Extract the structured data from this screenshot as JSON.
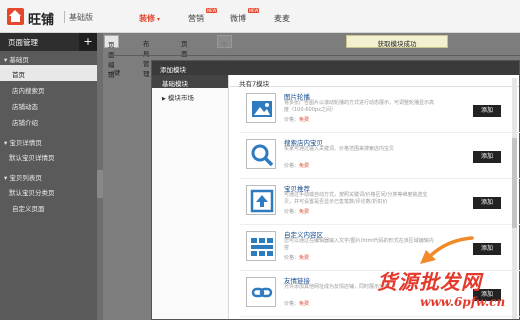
{
  "header": {
    "brand": "旺铺",
    "edition": "基础版",
    "nav": [
      {
        "label": "装修",
        "active": true,
        "caret": "▾"
      },
      {
        "label": "营销",
        "badge": "NEW"
      },
      {
        "label": "微博",
        "badge": "NEW"
      },
      {
        "label": "麦麦"
      }
    ]
  },
  "sidebar": {
    "title": "页面管理",
    "add_icon": "plus-icon",
    "groups": [
      {
        "label": "基础页",
        "items": [
          {
            "label": "首页",
            "active": true
          },
          {
            "label": "店内搜索页"
          },
          {
            "label": "店铺动态"
          },
          {
            "label": "店铺介绍"
          }
        ]
      },
      {
        "label": "宝贝详情页",
        "items": [
          {
            "label": "默认宝贝详情页"
          }
        ]
      },
      {
        "label": "宝贝列表页",
        "items": [
          {
            "label": "默认宝贝分类页"
          },
          {
            "label": "自定义页面"
          }
        ]
      }
    ]
  },
  "workspace": {
    "tabs": [
      {
        "label": "页面编辑",
        "active": true
      },
      {
        "label": "布局管理"
      },
      {
        "label": "页面属性"
      },
      {
        "label": "不可编辑",
        "disabled": true
      }
    ],
    "toast": "获取模块成功",
    "stub": "一键"
  },
  "modal": {
    "title": "添加模块",
    "left_header": "基础模块",
    "left_items": [
      {
        "label": "模块市场",
        "icon": "triangle-right-icon"
      }
    ],
    "right_header": "共有7模块",
    "price_label": "价格：",
    "modules": [
      {
        "name": "图片轮播",
        "desc": "将多张广告图片以滚动轮播的方式进行动态展示，可调整轮播显示高度（100-600px之间）",
        "price": "免费",
        "button": "添加",
        "icon": "image-carousel-icon"
      },
      {
        "name": "搜索店内宝贝",
        "desc": "买家可通过输入关键词、价格范围来搜索店内宝贝",
        "price": "免费",
        "button": "添加",
        "icon": "search-icon"
      },
      {
        "name": "宝贝推荐",
        "desc": "可通过手动或自动方式，按照关键词/价格区间/分类等维度挑选宝贝，并可设置是否显示已售笔数/评论数/折扣价",
        "price": "免费",
        "button": "添加",
        "icon": "upload-arrow-icon"
      },
      {
        "name": "自定义内容区",
        "desc": "您可以通过在编辑器输入文字/图片/html代码的形式在该区域编辑内容",
        "price": "免费",
        "button": "添加",
        "icon": "layout-grid-icon"
      },
      {
        "name": "友情链接",
        "desc": "允许添加其他网址成为友情店铺，同时展示分类",
        "price": "免费",
        "button": "添加",
        "icon": "link-icon"
      }
    ]
  },
  "watermark": {
    "text": "货源批发网",
    "url": "www.6pfw.cn"
  },
  "colors": {
    "accent": "#e5482d",
    "link": "#1a4d8f",
    "sidebar": "#5a5a5a",
    "watermark": "#e33a2c"
  }
}
